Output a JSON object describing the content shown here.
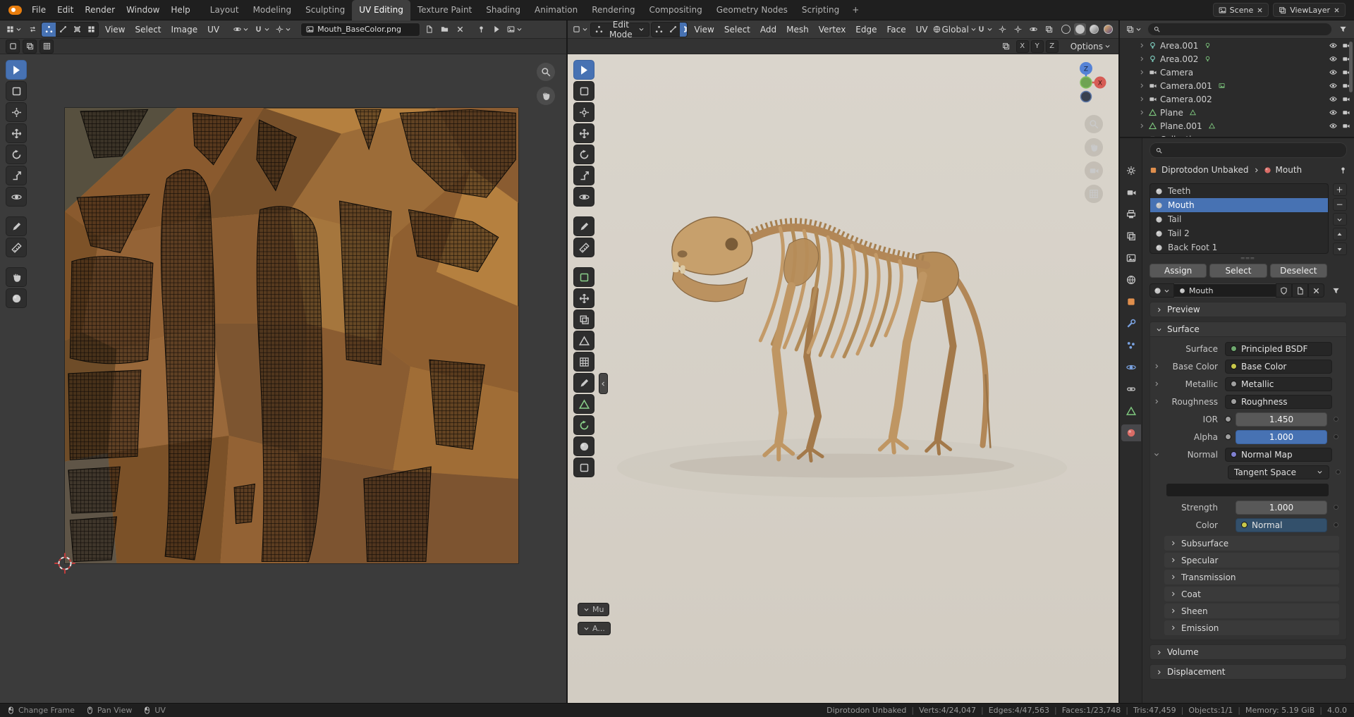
{
  "topbar": {
    "menus": [
      "File",
      "Edit",
      "Render",
      "Window",
      "Help"
    ],
    "workspaces": [
      {
        "label": "Layout"
      },
      {
        "label": "Modeling"
      },
      {
        "label": "Sculpting"
      },
      {
        "label": "UV Editing",
        "state": "active"
      },
      {
        "label": "Texture Paint"
      },
      {
        "label": "Shading"
      },
      {
        "label": "Animation"
      },
      {
        "label": "Rendering"
      },
      {
        "label": "Compositing"
      },
      {
        "label": "Geometry Nodes"
      },
      {
        "label": "Scripting"
      }
    ],
    "add_workspace": "+",
    "scene_label": "Scene",
    "viewlayer_label": "ViewLayer"
  },
  "uv_editor": {
    "menus": [
      "View",
      "Select",
      "Image",
      "UV"
    ],
    "image_name": "Mouth_BaseColor.png",
    "tools": [
      {
        "name": "tweak-tool",
        "icon": "#i-arrow",
        "state": "active"
      },
      {
        "name": "select-box-tool",
        "icon": "#i-box"
      },
      {
        "name": "cursor-tool",
        "icon": "#i-crosshair"
      },
      {
        "name": "move-tool",
        "icon": "#i-move"
      },
      {
        "name": "rotate-tool",
        "icon": "#i-rotate"
      },
      {
        "name": "scale-tool",
        "icon": "#i-scale"
      },
      {
        "name": "transform-tool",
        "icon": "#i-orbit"
      },
      {
        "name": "annotate-tool",
        "icon": "#i-pen",
        "state": "gap"
      },
      {
        "name": "measure-tool",
        "icon": "#i-ruler"
      },
      {
        "name": "grab-tool",
        "icon": "#i-hand",
        "state": "gap"
      },
      {
        "name": "relax-tool",
        "icon": "#i-sphere"
      }
    ]
  },
  "viewport": {
    "mode": "Edit Mode",
    "menus": [
      "View",
      "Select",
      "Add",
      "Mesh",
      "Vertex",
      "Edge",
      "Face",
      "UV"
    ],
    "orientation": "Global",
    "axes": [
      {
        "label": "X"
      },
      {
        "label": "Y"
      },
      {
        "label": "Z"
      }
    ],
    "options_label": "Options",
    "gizmo": {
      "z": "Z",
      "x": "X"
    },
    "overlay_tabs": [
      {
        "label": "Mu"
      },
      {
        "label": "A..."
      }
    ],
    "tools": [
      {
        "name": "tweak-tool",
        "icon": "#i-arrow",
        "state": "active"
      },
      {
        "name": "select-box-tool",
        "icon": "#i-box"
      },
      {
        "name": "cursor-tool",
        "icon": "#i-crosshair"
      },
      {
        "name": "move-tool",
        "icon": "#i-move"
      },
      {
        "name": "rotate-tool",
        "icon": "#i-rotate"
      },
      {
        "name": "scale-tool",
        "icon": "#i-scale"
      },
      {
        "name": "transform-tool",
        "icon": "#i-orbit"
      },
      {
        "name": "annotate-tool",
        "icon": "#i-pen",
        "state": "gap"
      },
      {
        "name": "measure-tool",
        "icon": "#i-ruler"
      },
      {
        "name": "add-cube-tool",
        "icon": "#i-box",
        "state": "gap green"
      },
      {
        "name": "extrude-tool",
        "icon": "#i-move"
      },
      {
        "name": "inset-faces-tool",
        "icon": "#i-layers"
      },
      {
        "name": "bevel-tool",
        "icon": "#i-tri"
      },
      {
        "name": "loop-cut-tool",
        "icon": "#i-grid"
      },
      {
        "name": "knife-tool",
        "icon": "#i-pen"
      },
      {
        "name": "poly-build-tool",
        "icon": "#i-tri",
        "state": "green"
      },
      {
        "name": "spin-tool",
        "icon": "#i-rotate",
        "state": "green"
      },
      {
        "name": "smooth-tool",
        "icon": "#i-sphere"
      },
      {
        "name": "shear-tool",
        "icon": "#i-box"
      }
    ]
  },
  "outliner": {
    "rows": [
      {
        "icon": "#i-bulb",
        "tint": "c-teal",
        "name": "Area.001",
        "e1": "#i-bulb"
      },
      {
        "icon": "#i-bulb",
        "tint": "c-teal",
        "name": "Area.002",
        "e1": "#i-bulb"
      },
      {
        "icon": "#i-cam",
        "tint": "c-gray",
        "name": "Camera"
      },
      {
        "icon": "#i-cam",
        "tint": "c-gray",
        "name": "Camera.001",
        "e1": "#i-image"
      },
      {
        "icon": "#i-cam",
        "tint": "c-gray",
        "name": "Camera.002"
      },
      {
        "icon": "#i-tri",
        "tint": "c-green",
        "name": "Plane",
        "e1": "#i-tri"
      },
      {
        "icon": "#i-tri",
        "tint": "c-green",
        "name": "Plane.001",
        "e1": "#i-tri"
      },
      {
        "icon": "#i-boxf",
        "tint": "c-gray",
        "name": "Collection"
      }
    ]
  },
  "properties": {
    "tabs": [
      {
        "name": "tool-tab",
        "icon": "#i-gear",
        "tint": "c-gray"
      },
      {
        "name": "render-tab",
        "icon": "#i-cam",
        "tint": "c-gray"
      },
      {
        "name": "output-tab",
        "icon": "#i-printer",
        "tint": "c-gray"
      },
      {
        "name": "view-layer-tab",
        "icon": "#i-layers",
        "tint": "c-gray"
      },
      {
        "name": "scene-tab",
        "icon": "#i-image",
        "tint": "c-gray"
      },
      {
        "name": "world-tab",
        "icon": "#i-world",
        "tint": "c-gray"
      },
      {
        "name": "object-tab",
        "icon": "#i-boxf",
        "tint": "c-orange"
      },
      {
        "name": "modifiers-tab",
        "icon": "#i-wrench",
        "tint": "c-blue"
      },
      {
        "name": "particles-tab",
        "icon": "#i-dots",
        "tint": "c-blue"
      },
      {
        "name": "physics-tab",
        "icon": "#i-orbit",
        "tint": "c-blue"
      },
      {
        "name": "constraints-tab",
        "icon": "#i-chain",
        "tint": "c-gray"
      },
      {
        "name": "object-data-tab",
        "icon": "#i-tri",
        "tint": "c-green"
      },
      {
        "name": "material-tab",
        "icon": "#i-sphere",
        "tint": "c-red",
        "state": "active"
      }
    ],
    "breadcrumb": {
      "object": "Diprotodon Unbaked",
      "data": "Mouth"
    },
    "slots": [
      {
        "name": "Teeth"
      },
      {
        "name": "Mouth",
        "state": "active"
      },
      {
        "name": "Tail"
      },
      {
        "name": "Tail 2"
      },
      {
        "name": "Back Foot 1"
      }
    ],
    "slot_buttons": [
      {
        "label": "Assign"
      },
      {
        "label": "Select"
      },
      {
        "label": "Deselect"
      }
    ],
    "material_name": "Mouth",
    "panels": {
      "preview": "Preview",
      "volume": "Volume",
      "displacement": "Displacement"
    },
    "surface": {
      "title": "Surface",
      "sockets": {
        "shader": "#6fa86f",
        "color": "#c8c84a",
        "float": "#a0a0a0",
        "vector": "#8080d0"
      },
      "surface_label": "Surface",
      "surface_value": "Principled BSDF",
      "base_color_label": "Base Color",
      "base_color_value": "Base Color",
      "metallic_label": "Metallic",
      "metallic_value": "Metallic",
      "roughness_label": "Roughness",
      "roughness_value": "Roughness",
      "ior_label": "IOR",
      "ior_value": "1.450",
      "alpha_label": "Alpha",
      "alpha_value": "1.000",
      "normal_label": "Normal",
      "normal_value": "Normal Map",
      "space_value": "Tangent Space",
      "strength_label": "Strength",
      "strength_value": "1.000",
      "color_label": "Color",
      "color_value": "Normal",
      "subpanels": [
        {
          "label": "Subsurface"
        },
        {
          "label": "Specular"
        },
        {
          "label": "Transmission"
        },
        {
          "label": "Coat"
        },
        {
          "label": "Sheen"
        },
        {
          "label": "Emission"
        }
      ]
    }
  },
  "statusbar": {
    "hints": [
      {
        "label": "Change Frame",
        "icon": "#i-mouse-l"
      },
      {
        "label": "Pan View",
        "icon": "#i-mouse-m"
      },
      {
        "label": "UV",
        "icon": "#i-mouse-l"
      }
    ],
    "stats": [
      {
        "t": "Diprotodon Unbaked"
      },
      {
        "t": "Verts:4/24,047"
      },
      {
        "t": "Edges:4/47,563"
      },
      {
        "t": "Faces:1/23,748"
      },
      {
        "t": "Tris:47,459"
      },
      {
        "t": "Objects:1/1"
      },
      {
        "t": "Memory: 5.19 GiB"
      },
      {
        "t": "4.0.0"
      }
    ]
  }
}
